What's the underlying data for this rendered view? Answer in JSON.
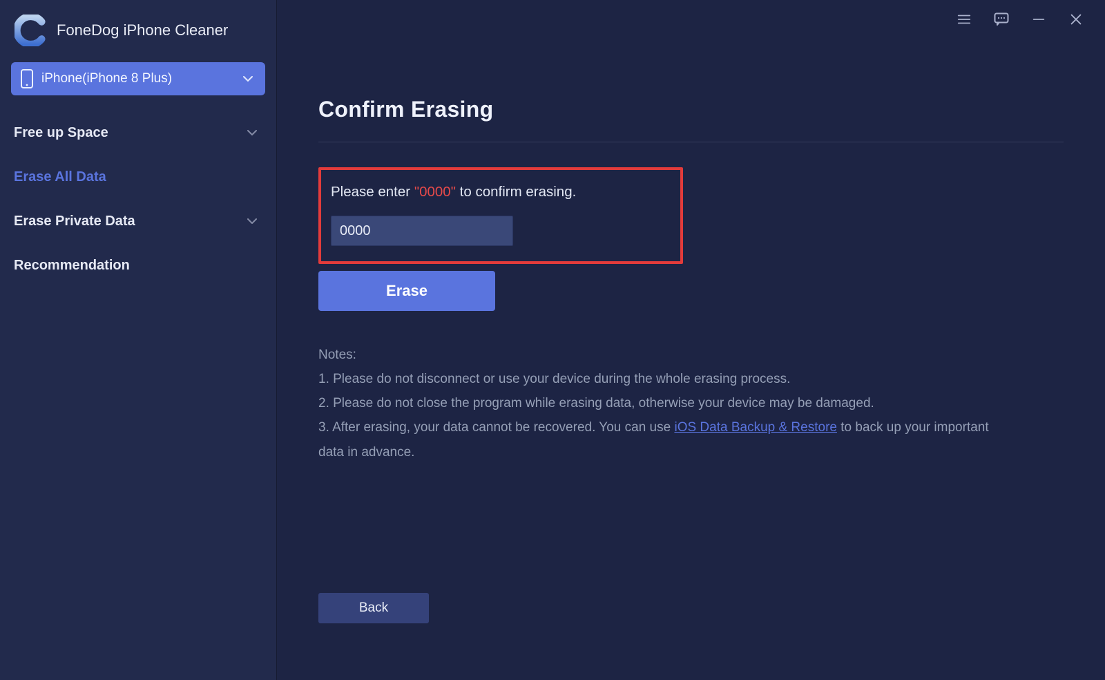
{
  "app": {
    "title": "FoneDog iPhone Cleaner"
  },
  "device": {
    "label": "iPhone(iPhone 8 Plus)"
  },
  "sidebar": {
    "items": [
      {
        "label": "Free up Space",
        "expandable": true,
        "active": false
      },
      {
        "label": "Erase All Data",
        "expandable": false,
        "active": true
      },
      {
        "label": "Erase Private Data",
        "expandable": true,
        "active": false
      },
      {
        "label": "Recommendation",
        "expandable": false,
        "active": false
      }
    ]
  },
  "page": {
    "title": "Confirm Erasing",
    "confirm_prefix": "Please enter ",
    "confirm_code_quoted": "\"0000\"",
    "confirm_suffix": " to confirm erasing.",
    "input_value": "0000",
    "erase_label": "Erase",
    "back_label": "Back"
  },
  "notes": {
    "heading": "Notes:",
    "n1": "1. Please do not disconnect or use your device during the whole erasing process.",
    "n2": "2. Please do not close the program while erasing data, otherwise your device may be damaged.",
    "n3_pre": "3. After erasing, your data cannot be recovered. You can use ",
    "n3_link": "iOS Data Backup & Restore",
    "n3_post": " to back up your important data in advance."
  }
}
